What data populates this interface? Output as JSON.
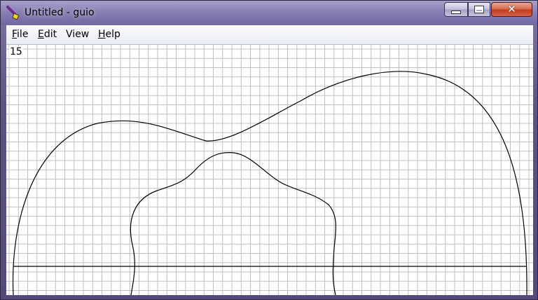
{
  "window": {
    "title": "Untitled - guio",
    "app_icon": "brush-app-icon",
    "controls": {
      "minimize_icon": "minimize-icon",
      "maximize_icon": "maximize-icon",
      "close_glyph": "✕"
    }
  },
  "menu": {
    "items": [
      {
        "accel": "F",
        "rest": "ile"
      },
      {
        "accel": "E",
        "rest": "dit"
      },
      {
        "accel": "",
        "rest": "View"
      },
      {
        "accel": "H",
        "rest": "elp"
      }
    ]
  },
  "canvas": {
    "counter": "15",
    "background": "#ffffff",
    "grid_color": "#c0c0c0",
    "stroke_color": "#000000"
  }
}
